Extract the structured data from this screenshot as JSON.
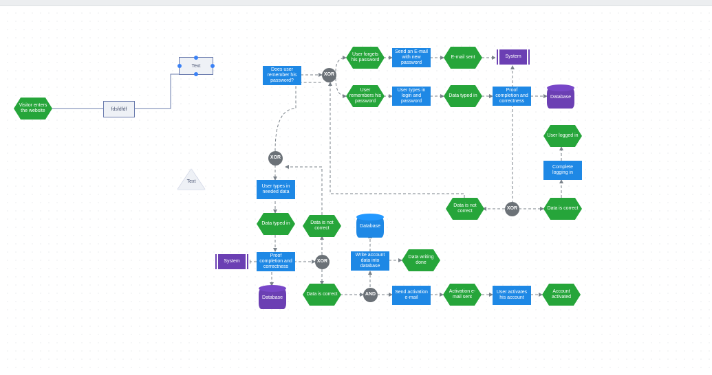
{
  "diagram": {
    "topbar": true,
    "palette": {
      "green": "#26a53a",
      "blue": "#1e88e5",
      "purple": "#6b3fb3",
      "greyGate": "#6b7177",
      "noteFill": "#eef1f6",
      "noteStroke": "#6b7cae"
    },
    "notes": {
      "text1": "Text",
      "text2": "fdsfdfdf",
      "tri": "Text"
    },
    "gates": {
      "xor1": "XOR",
      "xor2": "XOR",
      "xor3": "XOR",
      "xor4": "XOR",
      "and1": "AND"
    },
    "nodes": {
      "visitor": "Visitor enters the website",
      "remember_q": "Does user remember his password?",
      "forgets": "User forgets his password",
      "send_email": "Send an E-mail with new password",
      "email_sent": "E-mail sent",
      "system1": "System",
      "remembers": "User remembers his password",
      "types_login": "User types in login and password",
      "typed1": "Data typed in",
      "proof1": "Proof completion and correctness",
      "db1": "Database",
      "logged_in": "User logged in",
      "complete_login": "Complete logging in",
      "not_correct1": "Data is not correct",
      "data_correct1": "Data is correct",
      "types_data": "User types in needed data",
      "typed2": "Data typed in",
      "not_correct2": "Data is not correct",
      "db2": "Database",
      "system2": "System",
      "proof2": "Proof completion and correctness",
      "write_acct": "Write account data into database",
      "writing_done": "Data writing done",
      "db3": "Database",
      "correct2": "Data is correct",
      "send_act": "Send activation e-mail",
      "act_sent": "Activation e-mail sent",
      "user_act": "User activates his account",
      "acct_act": "Account activated"
    }
  }
}
